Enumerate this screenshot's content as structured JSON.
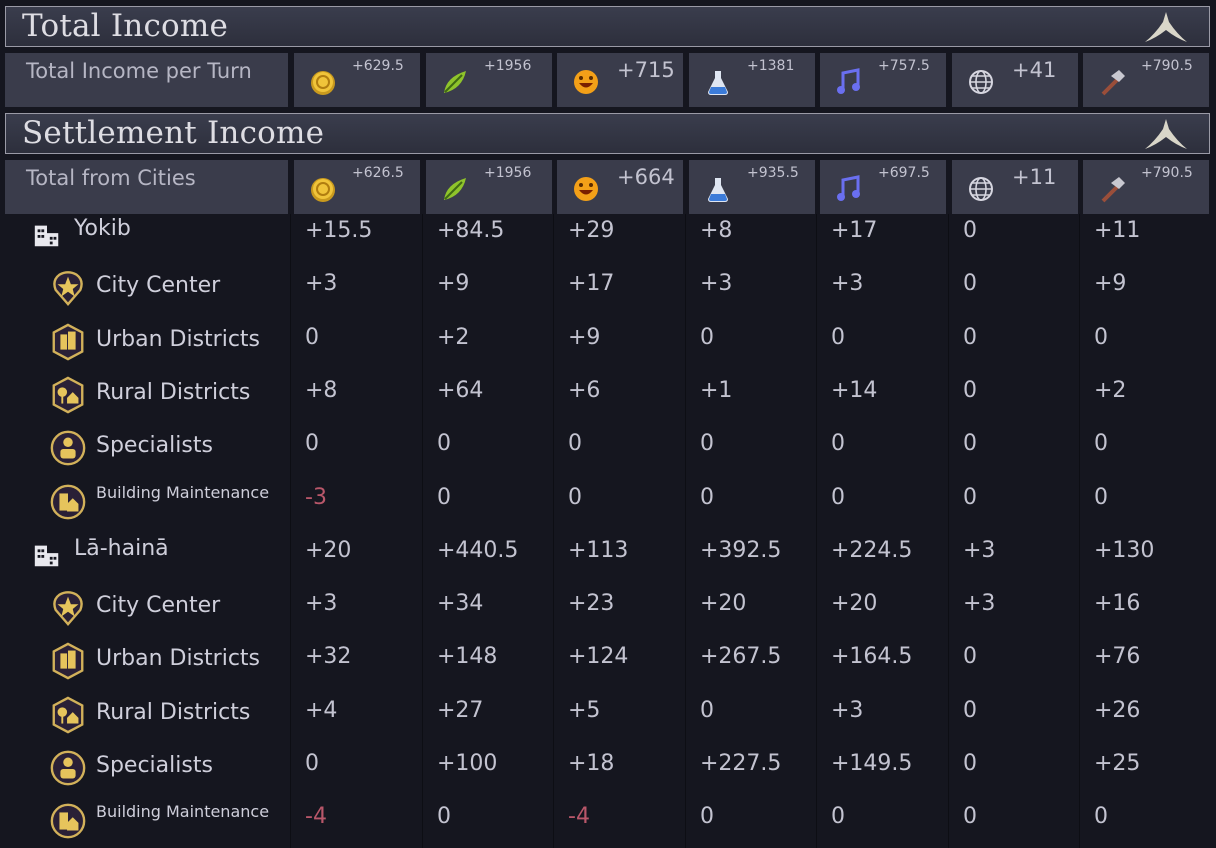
{
  "colors": {
    "accent_negative": "#b9576a",
    "header_bg": "#3a3c4b",
    "page_bg": "#15161f"
  },
  "sections": {
    "total_income_title": "Total Income",
    "settlement_income_title": "Settlement Income"
  },
  "resource_icons": [
    "gold-coin-icon",
    "food-leaf-icon",
    "happiness-face-icon",
    "science-flask-icon",
    "culture-note-icon",
    "influence-globe-icon",
    "production-hammer-icon"
  ],
  "total_per_turn": {
    "label": "Total Income per Turn",
    "values": [
      "+629.5",
      "+1956",
      "+715",
      "+1381",
      "+757.5",
      "+41",
      "+790.5"
    ]
  },
  "total_from_cities": {
    "label": "Total from Cities",
    "values": [
      "+626.5",
      "+1956",
      "+664",
      "+935.5",
      "+697.5",
      "+11",
      "+790.5"
    ]
  },
  "cities": [
    {
      "name": "Yokib",
      "values": [
        "+15.5",
        "+84.5",
        "+29",
        "+8",
        "+17",
        "0",
        "+11"
      ],
      "rows": [
        {
          "label": "City Center",
          "icon": "city-center-star-icon",
          "values": [
            "+3",
            "+9",
            "+17",
            "+3",
            "+3",
            "0",
            "+9"
          ]
        },
        {
          "label": "Urban Districts",
          "icon": "urban-districts-icon",
          "values": [
            "0",
            "+2",
            "+9",
            "0",
            "0",
            "0",
            "0"
          ]
        },
        {
          "label": "Rural Districts",
          "icon": "rural-districts-icon",
          "values": [
            "+8",
            "+64",
            "+6",
            "+1",
            "+14",
            "0",
            "+2"
          ]
        },
        {
          "label": "Specialists",
          "icon": "specialists-icon",
          "values": [
            "0",
            "0",
            "0",
            "0",
            "0",
            "0",
            "0"
          ]
        },
        {
          "label": "Building Maintenance",
          "icon": "building-maintenance-icon",
          "values": [
            "-3",
            "0",
            "0",
            "0",
            "0",
            "0",
            "0"
          ]
        }
      ]
    },
    {
      "name": "Lā-hainā",
      "values": [
        "+20",
        "+440.5",
        "+113",
        "+392.5",
        "+224.5",
        "+3",
        "+130"
      ],
      "rows": [
        {
          "label": "City Center",
          "icon": "city-center-star-icon",
          "values": [
            "+3",
            "+34",
            "+23",
            "+20",
            "+20",
            "+3",
            "+16"
          ]
        },
        {
          "label": "Urban Districts",
          "icon": "urban-districts-icon",
          "values": [
            "+32",
            "+148",
            "+124",
            "+267.5",
            "+164.5",
            "0",
            "+76"
          ]
        },
        {
          "label": "Rural Districts",
          "icon": "rural-districts-icon",
          "values": [
            "+4",
            "+27",
            "+5",
            "0",
            "+3",
            "0",
            "+26"
          ]
        },
        {
          "label": "Specialists",
          "icon": "specialists-icon",
          "values": [
            "0",
            "+100",
            "+18",
            "+227.5",
            "+149.5",
            "0",
            "+25"
          ]
        },
        {
          "label": "Building Maintenance",
          "icon": "building-maintenance-icon",
          "values": [
            "-4",
            "0",
            "-4",
            "0",
            "0",
            "0",
            "0"
          ]
        }
      ]
    }
  ]
}
